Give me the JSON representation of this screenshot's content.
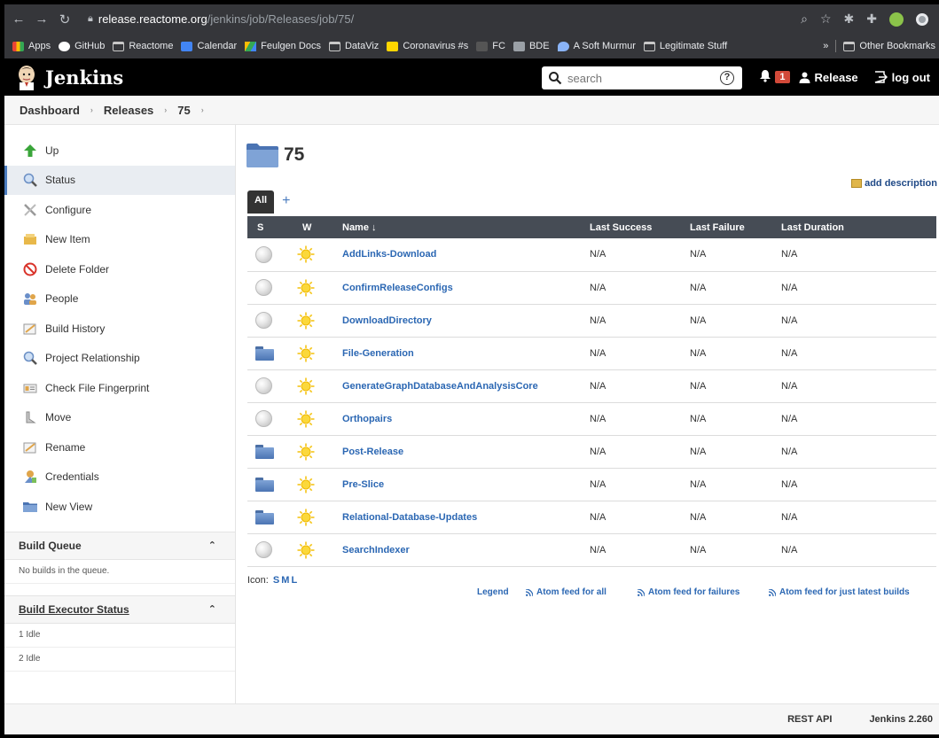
{
  "browser": {
    "url_host": "release.reactome.org",
    "url_path": "/jenkins/job/Releases/job/75/",
    "bookmarks": [
      {
        "label": "Apps",
        "icon": "apps-grid-icon"
      },
      {
        "label": "GitHub",
        "icon": "github-icon"
      },
      {
        "label": "Reactome",
        "icon": "folder-icon"
      },
      {
        "label": "Calendar",
        "icon": "calendar-icon"
      },
      {
        "label": "Feulgen Docs",
        "icon": "drive-icon"
      },
      {
        "label": "DataViz",
        "icon": "folder-icon"
      },
      {
        "label": "Coronavirus #s",
        "icon": "sheets-icon"
      },
      {
        "label": "FC",
        "icon": "fc-icon"
      },
      {
        "label": "BDE",
        "icon": "bde-icon"
      },
      {
        "label": "A Soft Murmur",
        "icon": "drop-icon"
      },
      {
        "label": "Legitimate Stuff",
        "icon": "folder-icon"
      }
    ],
    "more": "»",
    "other_bookmarks": "Other Bookmarks"
  },
  "header": {
    "title": "Jenkins",
    "search_placeholder": "search",
    "help": "?",
    "notifications_count": "1",
    "user": "Release",
    "logout": "log out"
  },
  "breadcrumb": [
    "Dashboard",
    "Releases",
    "75"
  ],
  "sidebar": {
    "items": [
      {
        "label": "Up",
        "icon": "up-arrow-icon",
        "active": false
      },
      {
        "label": "Status",
        "icon": "magnifier-icon",
        "active": true
      },
      {
        "label": "Configure",
        "icon": "wrench-screwdriver-icon",
        "active": false
      },
      {
        "label": "New Item",
        "icon": "new-item-icon",
        "active": false
      },
      {
        "label": "Delete Folder",
        "icon": "no-entry-icon",
        "active": false
      },
      {
        "label": "People",
        "icon": "people-icon",
        "active": false
      },
      {
        "label": "Build History",
        "icon": "notepad-icon",
        "active": false
      },
      {
        "label": "Project Relationship",
        "icon": "magnifier-icon",
        "active": false
      },
      {
        "label": "Check File Fingerprint",
        "icon": "fingerprint-icon",
        "active": false
      },
      {
        "label": "Move",
        "icon": "move-icon",
        "active": false
      },
      {
        "label": "Rename",
        "icon": "notepad-icon",
        "active": false
      },
      {
        "label": "Credentials",
        "icon": "credentials-icon",
        "active": false
      },
      {
        "label": "New View",
        "icon": "folder-icon",
        "active": false
      }
    ],
    "build_queue": {
      "title": "Build Queue",
      "empty": "No builds in the queue."
    },
    "executors": {
      "title": "Build Executor Status",
      "rows": [
        "1  Idle",
        "2  Idle"
      ]
    }
  },
  "main": {
    "title": "75",
    "add_description": "add description",
    "tabs": {
      "all": "All",
      "add": "+"
    },
    "columns": [
      "S",
      "W",
      "Name ↓",
      "Last Success",
      "Last Failure",
      "Last Duration"
    ],
    "jobs": [
      {
        "type": "job",
        "name": "AddLinks-Download",
        "last_success": "N/A",
        "last_failure": "N/A",
        "last_duration": "N/A"
      },
      {
        "type": "job",
        "name": "ConfirmReleaseConfigs",
        "last_success": "N/A",
        "last_failure": "N/A",
        "last_duration": "N/A"
      },
      {
        "type": "job",
        "name": "DownloadDirectory",
        "last_success": "N/A",
        "last_failure": "N/A",
        "last_duration": "N/A"
      },
      {
        "type": "folder",
        "name": "File-Generation",
        "last_success": "N/A",
        "last_failure": "N/A",
        "last_duration": "N/A"
      },
      {
        "type": "job",
        "name": "GenerateGraphDatabaseAndAnalysisCore",
        "last_success": "N/A",
        "last_failure": "N/A",
        "last_duration": "N/A"
      },
      {
        "type": "job",
        "name": "Orthopairs",
        "last_success": "N/A",
        "last_failure": "N/A",
        "last_duration": "N/A"
      },
      {
        "type": "folder",
        "name": "Post-Release",
        "last_success": "N/A",
        "last_failure": "N/A",
        "last_duration": "N/A"
      },
      {
        "type": "folder",
        "name": "Pre-Slice",
        "last_success": "N/A",
        "last_failure": "N/A",
        "last_duration": "N/A"
      },
      {
        "type": "folder",
        "name": "Relational-Database-Updates",
        "last_success": "N/A",
        "last_failure": "N/A",
        "last_duration": "N/A"
      },
      {
        "type": "job",
        "name": "SearchIndexer",
        "last_success": "N/A",
        "last_failure": "N/A",
        "last_duration": "N/A"
      }
    ],
    "icon_label": "Icon:",
    "icon_sizes": [
      "S",
      "M",
      "L"
    ],
    "legend": "Legend",
    "feeds": [
      "Atom feed for all",
      "Atom feed for failures",
      "Atom feed for just latest builds"
    ]
  },
  "footer": {
    "rest_api": "REST API",
    "version": "Jenkins 2.260"
  },
  "colors": {
    "header_bg": "#000000",
    "table_header": "#464c55",
    "link": "#2b67b3",
    "badge": "#d24939"
  }
}
